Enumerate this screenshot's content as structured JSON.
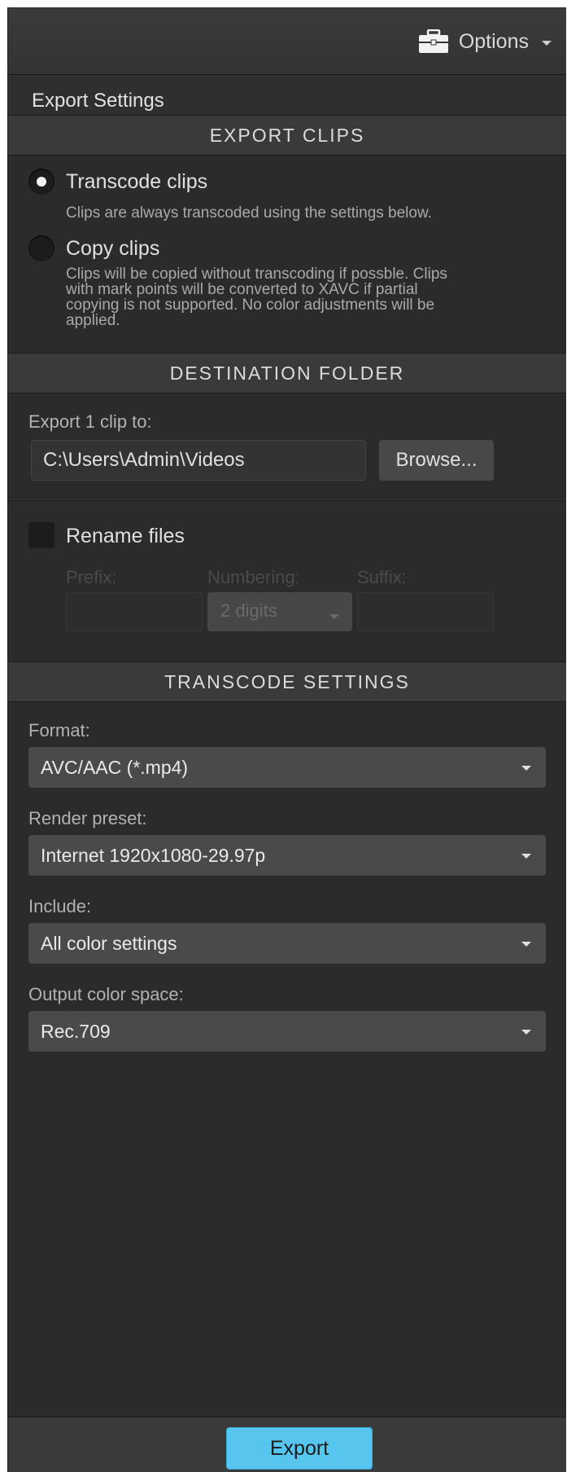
{
  "toolbar": {
    "options_label": "Options"
  },
  "panel_title": "Export Settings",
  "export_clips": {
    "header": "EXPORT CLIPS",
    "transcode_label": "Transcode clips",
    "transcode_desc": "Clips are always transcoded using the settings below.",
    "copy_label": "Copy clips",
    "copy_desc_1": "Clips will be copied without transcoding if possble. Clips",
    "copy_desc_2": "with mark points will be converted to XAVC if partial",
    "copy_desc_3": "copying is not supported. No color adjustments will be",
    "copy_desc_4": "applied.",
    "selected": "Transcode clips"
  },
  "destination": {
    "header": "DESTINATION FOLDER",
    "export_to_label": "Export 1 clip to:",
    "path_value": "C:\\Users\\Admin\\Videos",
    "browse_label": "Browse...",
    "rename_label": "Rename files",
    "rename_checked": false,
    "prefix_label": "Prefix:",
    "numbering_label": "Numbering:",
    "numbering_value": "2 digits",
    "suffix_label": "Suffix:"
  },
  "transcode": {
    "header": "TRANSCODE SETTINGS",
    "format_label": "Format:",
    "format_value": "AVC/AAC (*.mp4)",
    "preset_label": "Render preset:",
    "preset_value": "Internet 1920x1080-29.97p",
    "include_label": "Include:",
    "include_value": "All color settings",
    "colorspace_label": "Output color space:",
    "colorspace_value": "Rec.709"
  },
  "footer": {
    "export_label": "Export"
  },
  "colors": {
    "accent": "#56c6ef",
    "panel_bg": "#2b2b2b",
    "header_bg": "#3a3a3a"
  },
  "icons": {
    "options": "briefcase-icon",
    "dropdown": "chevron-down-icon"
  }
}
